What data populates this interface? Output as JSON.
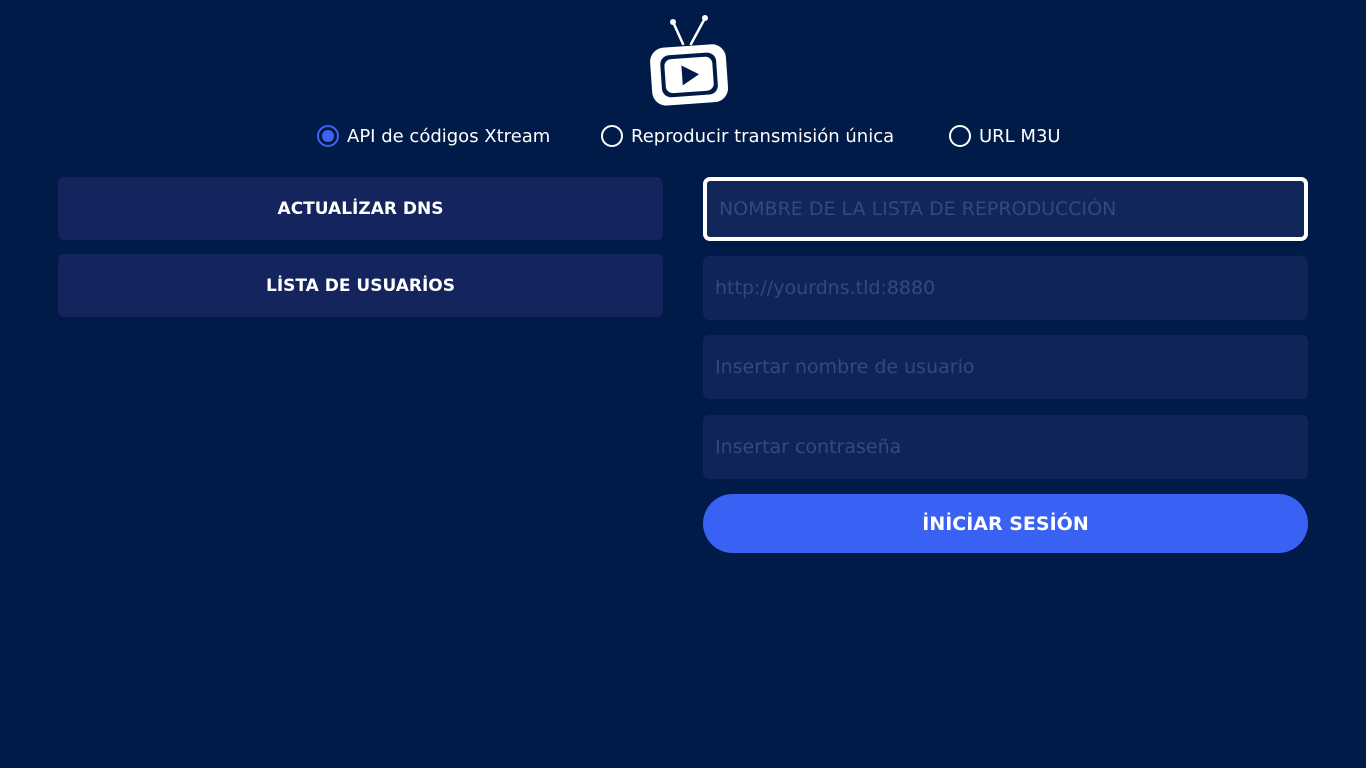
{
  "login_modes": [
    {
      "label": "API de códigos Xtream",
      "selected": true
    },
    {
      "label": "Reproducir transmisión única",
      "selected": false
    },
    {
      "label": "URL M3U",
      "selected": false
    }
  ],
  "left_panel": {
    "update_dns_label": "ACTUALİZAR DNS",
    "user_list_label": "LİSTA DE USUARİOS"
  },
  "form": {
    "playlist_name": {
      "value": "",
      "placeholder": "NOMBRE DE LA LISTA DE REPRODUCCIÓN"
    },
    "dns_url": {
      "value": "",
      "placeholder": "http://yourdns.tld:8880"
    },
    "username": {
      "value": "",
      "placeholder": "Insertar nombre de usuario"
    },
    "password": {
      "value": "",
      "placeholder": "Insertar contraseña"
    },
    "login_label": "İNİCİAR SESİÓN"
  },
  "icons": {
    "logo": "tv-play-icon"
  },
  "colors": {
    "background": "#001b47",
    "accent": "#3962f4",
    "panel": "#14245c",
    "field": "#0f2457"
  }
}
